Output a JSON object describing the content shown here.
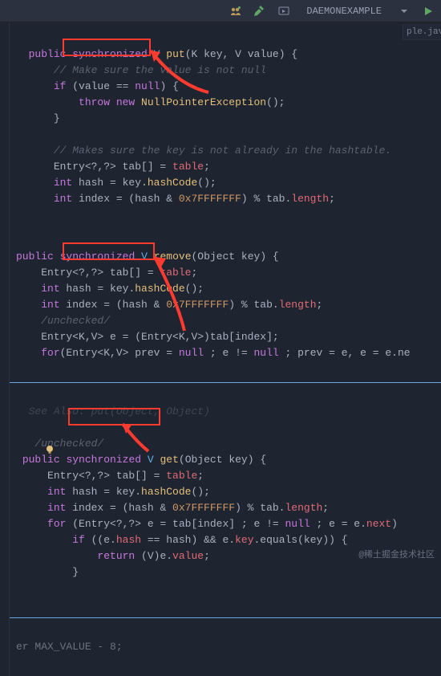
{
  "toolbar": {
    "run_config": "DAEMONEXAMPLE"
  },
  "tab_ghost": "ple.jav",
  "block1": {
    "l1_pub": "public",
    "l1_sync": "synchronized",
    "l1_ret": "V",
    "l1_fn": "put",
    "l1_params": "(K key, V value) {",
    "l2": "// Make sure the value is not null",
    "l3_if": "if",
    "l3_cond": " (value == ",
    "l3_null": "null",
    "l3_brace": ") {",
    "l4_throw": "throw",
    "l4_new": " new ",
    "l4_ex": "NullPointerException",
    "l4_end": "();",
    "l5": "}",
    "l7": "// Makes sure the key is not already in the hashtable.",
    "l8_a": "Entry<?,?> tab[] = ",
    "l8_b": "table",
    "l8_c": ";",
    "l9_a": "int",
    "l9_b": " hash = key.",
    "l9_c": "hashCode",
    "l9_d": "();",
    "l10_a": "int",
    "l10_b": " index = (hash & ",
    "l10_c": "0x7FFFFFFF",
    "l10_d": ") % tab.",
    "l10_e": "length",
    "l10_f": ";"
  },
  "block2": {
    "l1_pub": "public",
    "l1_sync": "synchronized",
    "l1_ret": "V",
    "l1_fn": "remove",
    "l1_params": "(Object key) {",
    "l2_a": "Entry<?,?> tab[] = ",
    "l2_b": "table",
    "l2_c": ";",
    "l3_a": "int",
    "l3_b": " hash = key.",
    "l3_c": "hashCode",
    "l3_d": "();",
    "l4_a": "int",
    "l4_b": " index = (hash & ",
    "l4_c": "0x7FFFFFFF",
    "l4_d": ") % tab.",
    "l4_e": "length",
    "l4_f": ";",
    "l5": "/unchecked/",
    "l6_a": "Entry<K,V> e = (Entry<K,V>)tab[index];",
    "l7_a": "for",
    "l7_b": "(Entry<K,V> prev = ",
    "l7_c": "null",
    "l7_d": " ; e != ",
    "l7_e": "null",
    "l7_f": " ; prev = e, e = e.ne"
  },
  "block3": {
    "l0": "See Also: put(Object, Object)",
    "l1": "/unchecked/",
    "l2_pub": "public",
    "l2_sync": "synchronized",
    "l2_ret": "V",
    "l2_fn": "get",
    "l2_params": "(Object key) {",
    "l3_a": "Entry<?,?> tab[] = ",
    "l3_b": "table",
    "l3_c": ";",
    "l4_a": "int",
    "l4_b": " hash = key.",
    "l4_c": "hashCode",
    "l4_d": "();",
    "l5_a": "int",
    "l5_b": " index = (hash & ",
    "l5_c": "0x7FFFFFFF",
    "l5_d": ") % tab.",
    "l5_e": "length",
    "l5_f": ";",
    "l6_a": "for",
    "l6_b": " (Entry<?,?> e = tab[index] ; e != ",
    "l6_c": "null",
    "l6_d": " ; e = e.",
    "l6_e": "next",
    "l6_f": ") ",
    "l7_a": "if",
    "l7_b": " ((e.",
    "l7_c": "hash",
    "l7_d": " == hash) && e.",
    "l7_e": "key",
    "l7_f": ".equals(key)) {",
    "l8_a": "return",
    "l8_b": " (V)e.",
    "l8_c": "value",
    "l8_d": ";",
    "l9": "}"
  },
  "footer": "er MAX_VALUE - 8;",
  "watermark": "@稀土掘金技术社区"
}
